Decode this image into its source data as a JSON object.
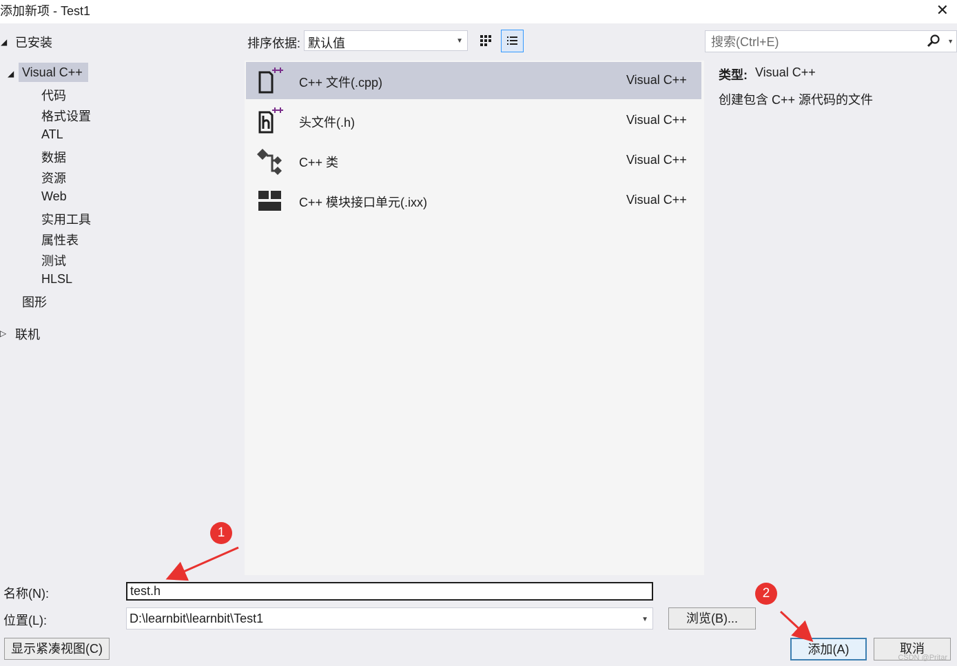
{
  "window": {
    "title": "添加新项 - Test1",
    "close_glyph": "✕"
  },
  "tree": {
    "installed": "已安装",
    "visual_cpp": "Visual C++",
    "children": [
      "代码",
      "格式设置",
      "ATL",
      "数据",
      "资源",
      "Web",
      "实用工具",
      "属性表",
      "测试",
      "HLSL"
    ],
    "graphics": "图形",
    "online": "联机"
  },
  "toolbar": {
    "sort_label": "排序依据:",
    "sort_value": "默认值"
  },
  "items": [
    {
      "name": "C++ 文件(.cpp)",
      "lang": "Visual C++",
      "icon": "cpp-file-icon",
      "selected": true
    },
    {
      "name": "头文件(.h)",
      "lang": "Visual C++",
      "icon": "header-file-icon",
      "selected": false
    },
    {
      "name": "C++ 类",
      "lang": "Visual C++",
      "icon": "cpp-class-icon",
      "selected": false
    },
    {
      "name": "C++ 模块接口单元(.ixx)",
      "lang": "Visual C++",
      "icon": "module-interface-icon",
      "selected": false
    }
  ],
  "details": {
    "search_placeholder": "搜索(Ctrl+E)",
    "type_label": "类型:",
    "type_value": "Visual C++",
    "description": "创建包含 C++ 源代码的文件"
  },
  "form": {
    "name_label": "名称(N):",
    "name_value": "test.h",
    "location_label": "位置(L):",
    "location_value": "D:\\learnbit\\learnbit\\Test1",
    "browse": "浏览(B)...",
    "compact_view": "显示紧凑视图(C)",
    "add": "添加(A)",
    "cancel": "取消"
  },
  "annotations": {
    "badge1": "1",
    "badge2": "2",
    "annotation_color": "#e8322f"
  },
  "watermark": "CSDN @Pritar",
  "colors": {
    "selection": "#c9ccd9",
    "accent": "#3399ff",
    "background": "#eeeef2",
    "list_bg": "#f5f5f5"
  }
}
